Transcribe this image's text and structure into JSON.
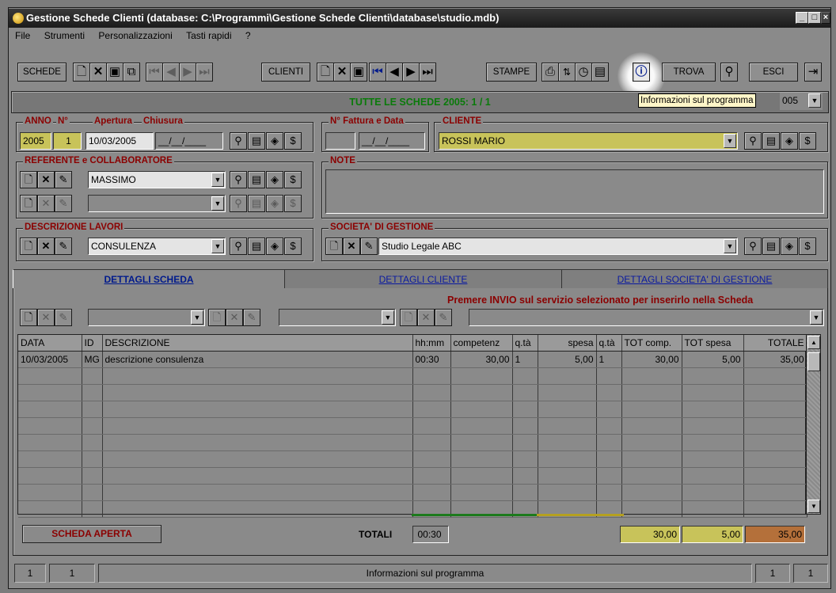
{
  "window": {
    "title": "Gestione Schede Clienti (database: C:\\Programmi\\Gestione Schede Clienti\\database\\studio.mdb)"
  },
  "menu": [
    "File",
    "Strumenti",
    "Personalizzazioni",
    "Tasti rapidi",
    "?"
  ],
  "toolbar": {
    "schede": "SCHEDE",
    "clienti": "CLIENTI",
    "stampe": "STAMPE",
    "trova": "TROVA",
    "esci": "ESCI",
    "icons": [
      "new-icon",
      "delete-icon",
      "save-icon",
      "copy-icon",
      "first-record-icon",
      "previous-record-icon",
      "next-record-icon",
      "last-record-icon",
      "print-icon",
      "sort-icon",
      "clock-icon",
      "notes-icon",
      "info-icon",
      "binoculars-icon",
      "exit-door-icon"
    ]
  },
  "banner": "TUTTE LE SCHEDE 2005: 1 / 1",
  "tooltip": "Informazioni sul programma",
  "year_select": "005",
  "scheda": {
    "anno_label": "ANNO",
    "num_label": "N°",
    "apertura_label": "Apertura",
    "chiusura_label": "Chiusura",
    "anno": "2005",
    "num": "1",
    "apertura": "10/03/2005",
    "chiusura": "__/__/____"
  },
  "fattura": {
    "label": "N° Fattura e Data",
    "number": "",
    "date": "__/__/____"
  },
  "cliente": {
    "label": "CLIENTE",
    "value": "ROSSI MARIO"
  },
  "referente": {
    "label": "REFERENTE e COLLABORATORE",
    "value": "MASSIMO",
    "value2": ""
  },
  "note": {
    "label": "NOTE",
    "value": ""
  },
  "lavori": {
    "label": "DESCRIZIONE LAVORI",
    "value": "CONSULENZA"
  },
  "societa": {
    "label": "SOCIETA' DI GESTIONE",
    "value": "Studio Legale ABC"
  },
  "tabs": [
    "DETTAGLI SCHEDA",
    "DETTAGLI CLIENTE",
    "DETTAGLI SOCIETA' DI GESTIONE"
  ],
  "hint": "Premere INVIO sul servizio selezionato per inserirlo nella Scheda",
  "grid": {
    "columns": [
      "DATA",
      "ID",
      "DESCRIZIONE",
      "hh:mm",
      "competenz",
      "q.tà",
      "spesa",
      "q.tà",
      "TOT comp.",
      "TOT spesa",
      "TOTALE"
    ],
    "rows": [
      [
        "10/03/2005",
        "MG",
        "descrizione consulenza",
        "00:30",
        "30,00",
        "1",
        "5,00",
        "1",
        "30,00",
        "5,00",
        "35,00"
      ]
    ]
  },
  "footer": {
    "status_badge": "SCHEDA APERTA",
    "totali_label": "TOTALI",
    "tot_time": "00:30",
    "tot_comp": "30,00",
    "tot_spesa": "5,00",
    "totale": "35,00"
  },
  "statusbar": {
    "left1": "1",
    "left2": "1",
    "message": "Informazioni sul programma",
    "right1": "1",
    "right2": "1"
  }
}
